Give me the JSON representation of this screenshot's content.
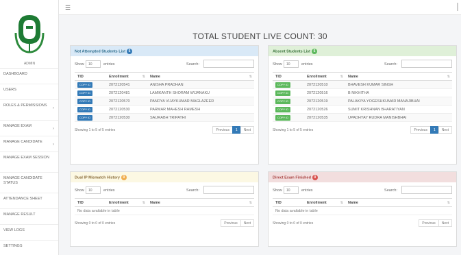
{
  "sidebar": {
    "logo_label": "ADMIN",
    "items": [
      {
        "label": "DASHBOARD",
        "caret": false
      },
      {
        "label": "USERS",
        "caret": false
      },
      {
        "label": "ROLES & PERMISSIONS",
        "caret": true
      },
      {
        "label": "MANAGE EXAM",
        "caret": true
      },
      {
        "label": "MANAGE CANDIDATE",
        "caret": true
      },
      {
        "label": "MANAGE EXAM SESSION",
        "caret": false
      },
      {
        "label": "MANAGE CANDIDATE STATUS",
        "caret": false
      },
      {
        "label": "ATTENDANCE SHEET",
        "caret": false
      },
      {
        "label": "MANAGE RESULT",
        "caret": false
      },
      {
        "label": "VIEW LOGS",
        "caret": false
      },
      {
        "label": "SETTINGS",
        "caret": false
      }
    ]
  },
  "topbar": {
    "menu_icon": "☰"
  },
  "main": {
    "title": "TOTAL STUDENT LIVE COUNT: 30"
  },
  "panels": {
    "not_attempted": {
      "title": "Not Attempted Students List",
      "badge": "5",
      "show": "Show",
      "select_value": "10",
      "entries": "entries",
      "search": "Search:",
      "columns": [
        "TID",
        "Enrollment",
        "Name"
      ],
      "rows": [
        {
          "tid": "COPY ID",
          "enrollment": "2072120541",
          "name": "ANISHA PRADHAN"
        },
        {
          "tid": "COPY ID",
          "enrollment": "2072120481",
          "name": "LAMIKANTH SHORAM WIJANAKU"
        },
        {
          "tid": "COPY ID",
          "enrollment": "2072120570",
          "name": "PANDYA VIJAYKUMAR MAGLAZEER"
        },
        {
          "tid": "COPY ID",
          "enrollment": "2072120530",
          "name": "PARMAR MAHESH RAMESH"
        },
        {
          "tid": "COPY ID",
          "enrollment": "2072120530",
          "name": "SAURABH TRIPATHI"
        }
      ],
      "info": "Showing 1 to 5 of 5 entries",
      "prev": "Previous",
      "page": "1",
      "next": "Next"
    },
    "absent": {
      "title": "Absent Students List",
      "badge": "5",
      "show": "Show",
      "select_value": "10",
      "entries": "entries",
      "search": "Search:",
      "columns": [
        "TID",
        "Enrollment",
        "Name"
      ],
      "rows": [
        {
          "tid": "COPY ID",
          "enrollment": "2072120510",
          "name": "BHAVESH KUMAR SINGH"
        },
        {
          "tid": "COPY ID",
          "enrollment": "2072120516",
          "name": "B NIKHITHA"
        },
        {
          "tid": "COPY ID",
          "enrollment": "2072120519",
          "name": "PALAKIYA YOGESHKUMAR MANAJIBHAI"
        },
        {
          "tid": "COPY ID",
          "enrollment": "2072120526",
          "name": "SUMIT KRISHNAN BHARATIYAN"
        },
        {
          "tid": "COPY ID",
          "enrollment": "2072120535",
          "name": "UPADHYAY RUDRA MANISHBHAI"
        }
      ],
      "info": "Showing 1 to 5 of 5 entries",
      "prev": "Previous",
      "page": "1",
      "next": "Next"
    },
    "ip_mismatch": {
      "title": "Dual IP Mismatch History",
      "badge": "0",
      "show": "Show",
      "select_value": "10",
      "entries": "entries",
      "search": "Search:",
      "columns": [
        "TID",
        "Enrollment",
        "Name"
      ],
      "empty": "No data available in table",
      "info": "Showing 0 to 0 of 0 entries",
      "prev": "Previous",
      "next": "Next"
    },
    "exam_finished": {
      "title": "Direct Exam Finished",
      "badge": "0",
      "show": "Show",
      "select_value": "10",
      "entries": "entries",
      "search": "Search:",
      "columns": [
        "TID",
        "Enrollment",
        "Name"
      ],
      "empty": "No data available in table",
      "info": "Showing 0 to 0 of 0 entries",
      "prev": "Previous",
      "next": "Next"
    }
  },
  "colors": {
    "primary": "#337ab7",
    "success": "#5cb85c",
    "warning": "#f0ad4e",
    "danger": "#d9534f"
  }
}
